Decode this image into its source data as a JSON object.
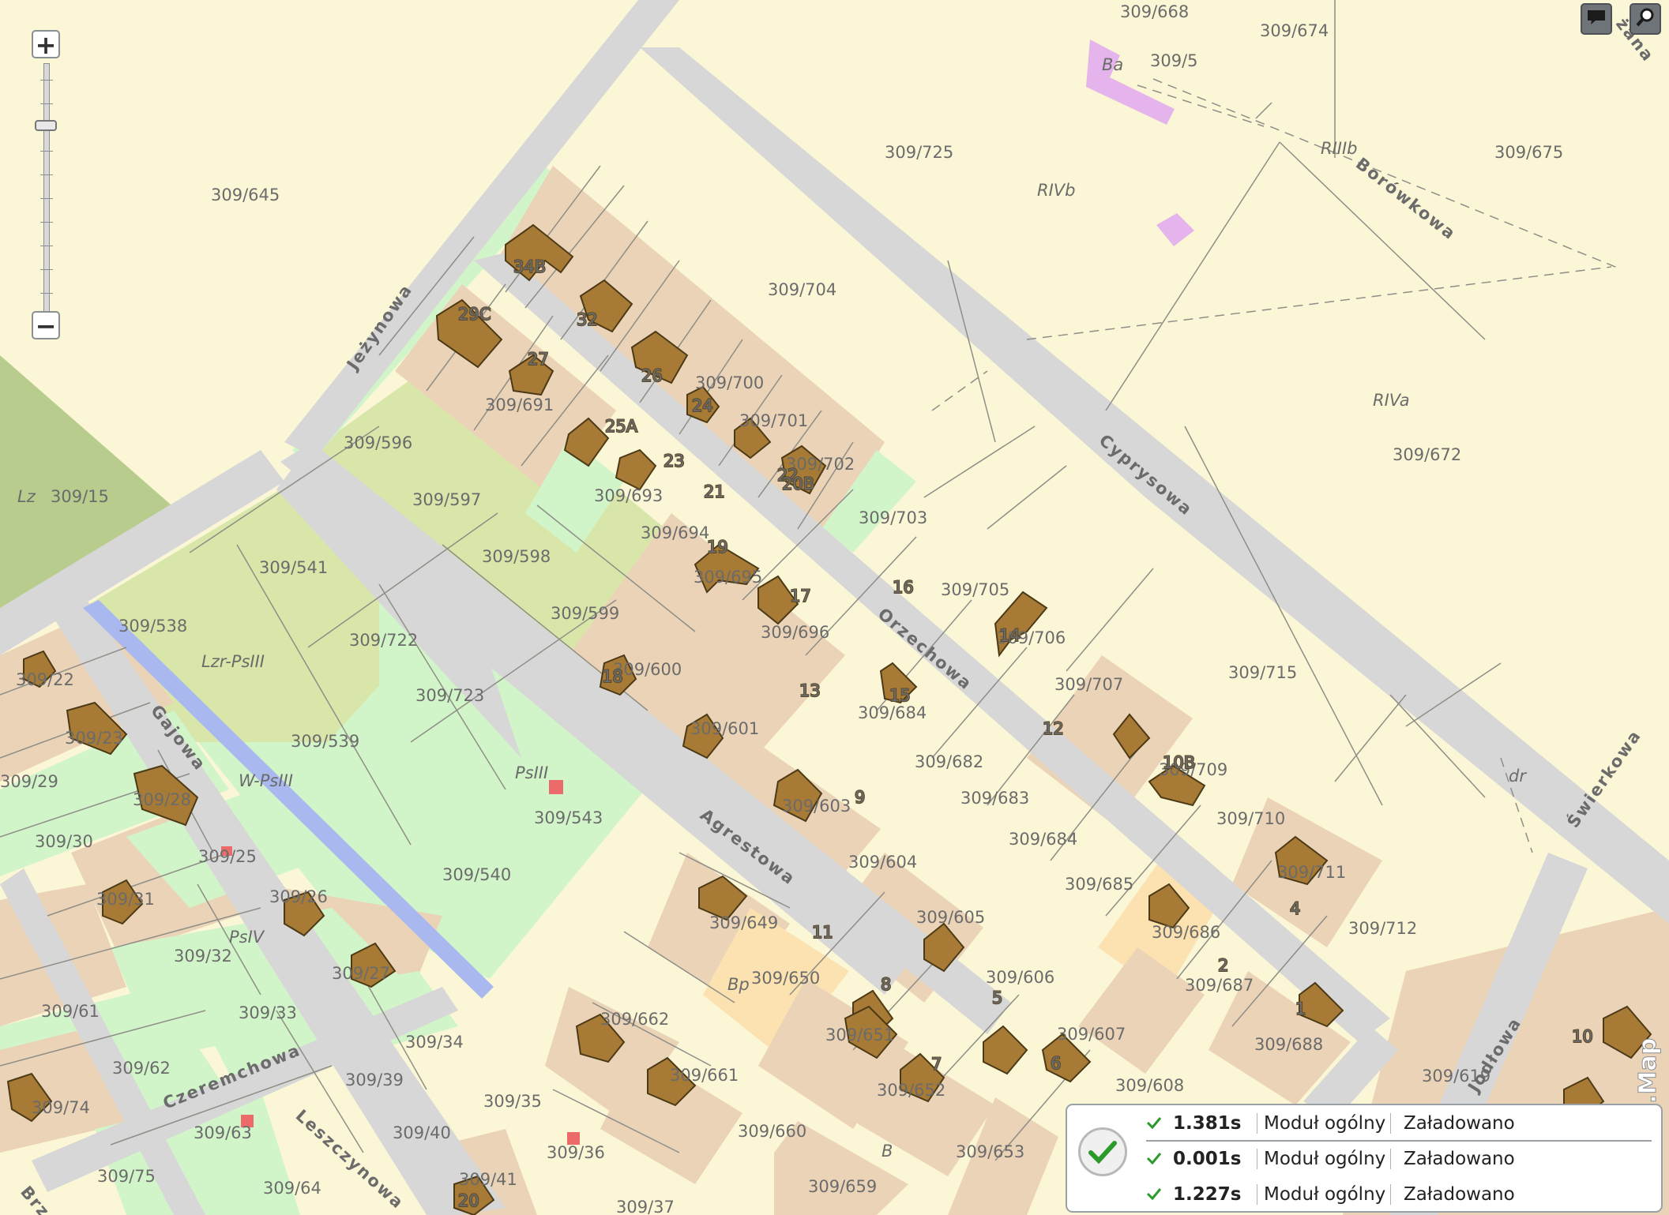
{
  "map": {
    "colors": {
      "background": "#fbf7d6",
      "road": "#d7d7d7",
      "built_plot": "#ebd3b7",
      "building": "#a77a35",
      "building_border": "#4c3a17",
      "meadow": "#d1f5c9",
      "arable": "#d8e7a9",
      "forest": "#b8cc8e",
      "water": "#a9b9ef",
      "lot_lines": "#8e8e86",
      "highlight_plot": "#fbe2b0",
      "special": "#e5b4ec",
      "marker": "#ec6a6a"
    },
    "streets": [
      "Jeżynowa",
      "Cyprysowa",
      "Borówkowa",
      "Orzechowa",
      "Agrestowa",
      "Gajowa",
      "Czeremchowa",
      "Leszczynowa",
      "Świerkowa",
      "Jodłowa",
      "Brzoz",
      "żana"
    ],
    "parcels": [
      "309/668",
      "309/674",
      "309/5",
      "309/725",
      "309/675",
      "309/645",
      "309/704",
      "309/672",
      "309/15",
      "309/596",
      "309/691",
      "309/700",
      "309/701",
      "309/702",
      "309/693",
      "309/597",
      "309/694",
      "309/703",
      "309/541",
      "309/598",
      "309/695",
      "309/705",
      "309/706",
      "309/538",
      "309/599",
      "309/722",
      "309/696",
      "309/715",
      "309/600",
      "309/707",
      "309/723",
      "309/22",
      "309/684",
      "309/601",
      "309/539",
      "309/682",
      "309/709",
      "309/683",
      "309/23",
      "309/603",
      "309/710",
      "309/29",
      "309/28",
      "309/543",
      "309/684",
      "309/30",
      "309/25",
      "309/604",
      "309/711",
      "309/685",
      "309/540",
      "309/26",
      "309/605",
      "309/649",
      "309/31",
      "309/686",
      "309/712",
      "309/32",
      "309/650",
      "309/27",
      "309/606",
      "309/687",
      "309/662",
      "309/33",
      "309/651",
      "309/607",
      "309/688",
      "309/61",
      "309/34",
      "309/62",
      "309/661",
      "309/652",
      "309/608",
      "309/619",
      "309/39",
      "309/35",
      "309/74",
      "309/660",
      "309/63",
      "309/40",
      "309/36",
      "309/653",
      "309/75",
      "309/64",
      "309/41",
      "309/37",
      "309/659"
    ],
    "land_use": [
      "Ba",
      "RIVb",
      "RIIIb",
      "RIVa",
      "Lz",
      "Lzr-PsIII",
      "W-PsIII",
      "PsIII",
      "PsIV",
      "Bp",
      "B",
      "dr"
    ],
    "house_numbers": [
      "34B",
      "32",
      "29C",
      "27",
      "26",
      "25A",
      "24",
      "23",
      "22",
      "21",
      "20B",
      "19",
      "17",
      "18",
      "16",
      "15",
      "14",
      "13",
      "12",
      "11",
      "10B",
      "9",
      "8",
      "7",
      "6",
      "5",
      "4",
      "2",
      "1",
      "10",
      "20"
    ]
  },
  "zoom": {
    "plus": "+",
    "minus": "−",
    "level_fraction": 0.25
  },
  "toolbar": {
    "comment_icon": "speech-bubble-icon",
    "search_icon": "magnifier-icon"
  },
  "status": {
    "rows": [
      {
        "time": "1.381s",
        "module": "Moduł ogólny",
        "state": "Załadowano"
      },
      {
        "time": "0.001s",
        "module": "Moduł ogólny",
        "state": "Załadowano"
      },
      {
        "time": "1.227s",
        "module": "Moduł ogólny",
        "state": "Załadowano"
      }
    ],
    "icon": "check-circle-icon"
  },
  "brand": {
    "text": "i.Map"
  }
}
